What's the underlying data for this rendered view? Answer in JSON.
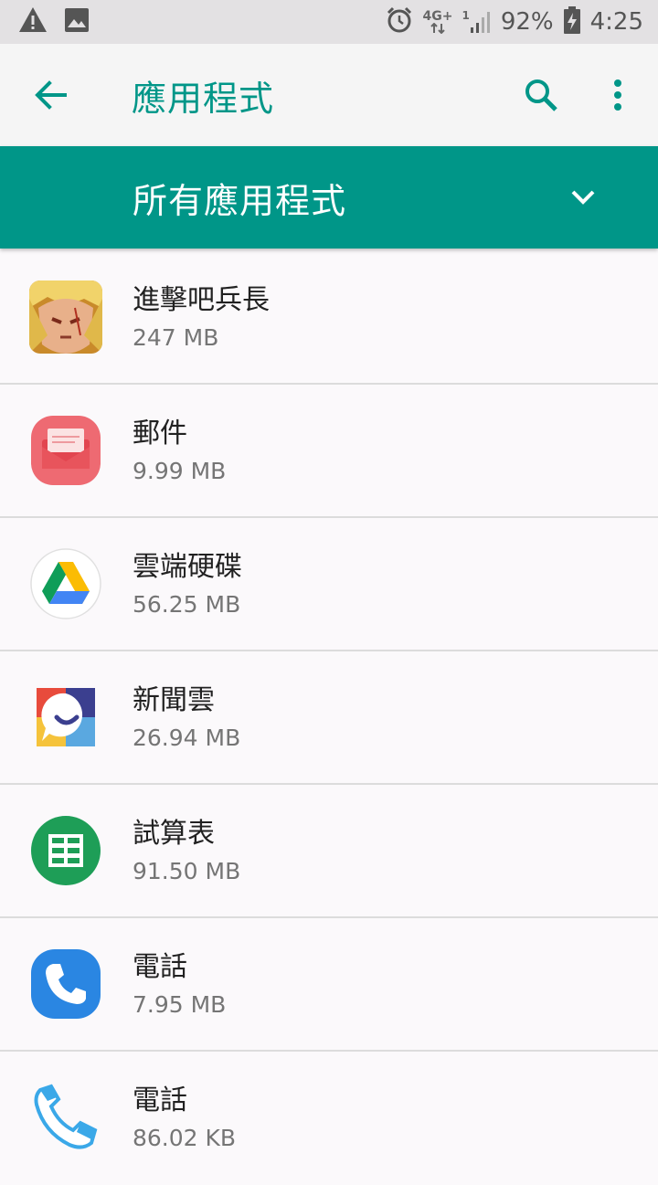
{
  "status_bar": {
    "network_top": "4G+",
    "network_sub": "1",
    "battery": "92%",
    "time": "4:25"
  },
  "app_bar": {
    "title": "應用程式"
  },
  "filter": {
    "label": "所有應用程式"
  },
  "apps": [
    {
      "name": "進擊吧兵長",
      "size": "247 MB",
      "icon": "game-character-icon"
    },
    {
      "name": "郵件",
      "size": "9.99 MB",
      "icon": "mail-envelope-icon"
    },
    {
      "name": "雲端硬碟",
      "size": "56.25 MB",
      "icon": "google-drive-icon"
    },
    {
      "name": "新聞雲",
      "size": "26.94 MB",
      "icon": "news-cloud-icon"
    },
    {
      "name": "試算表",
      "size": "91.50 MB",
      "icon": "sheets-icon"
    },
    {
      "name": "電話",
      "size": "7.95 MB",
      "icon": "phone-blue-icon"
    },
    {
      "name": "電話",
      "size": "86.02 KB",
      "icon": "phone-handset-icon"
    }
  ],
  "colors": {
    "accent": "#009688",
    "background": "#fbf9fb",
    "appbar": "#f5f5f5",
    "statusbar": "#e3e1e3"
  }
}
